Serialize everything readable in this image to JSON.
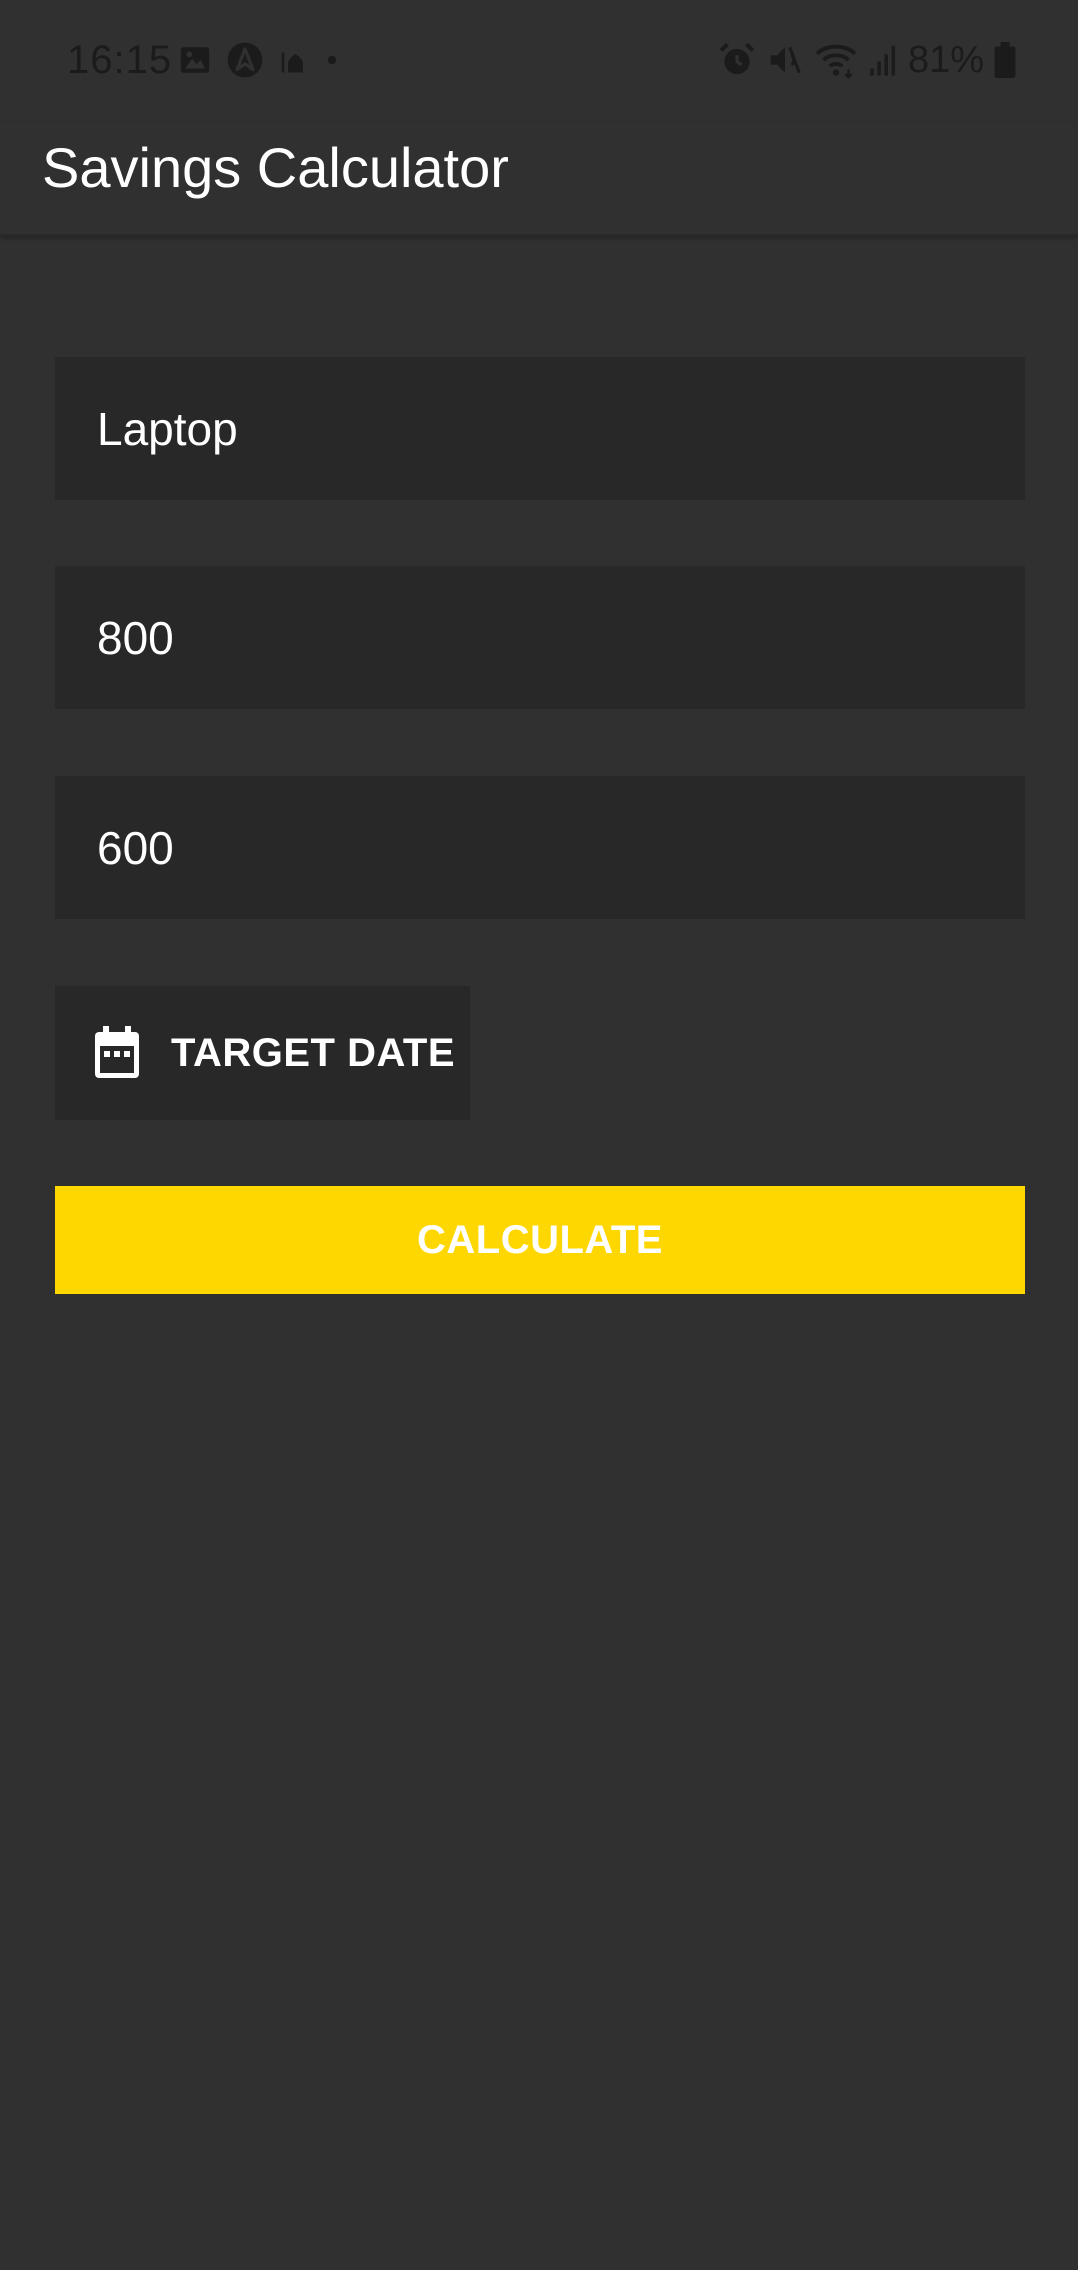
{
  "status_bar": {
    "time": "16:15",
    "battery_percent": "81%",
    "left_icons": [
      "image-icon",
      "navigation-icon",
      "mosque-icon",
      "dot-icon"
    ],
    "right_icons": [
      "alarm-icon",
      "mute-icon",
      "wifi-icon",
      "signal-icon",
      "battery-icon"
    ]
  },
  "app_bar": {
    "title": "Savings Calculator"
  },
  "form": {
    "name_value": "Laptop",
    "target_amount_value": "800",
    "saved_amount_value": "600",
    "date_button_label": "TARGET DATE",
    "date_button_icon": "calendar-icon",
    "calculate_button_label": "CALCULATE"
  },
  "colors": {
    "background": "#303030",
    "field_background": "#282828",
    "accent": "#ffd700",
    "text": "#ffffff"
  }
}
